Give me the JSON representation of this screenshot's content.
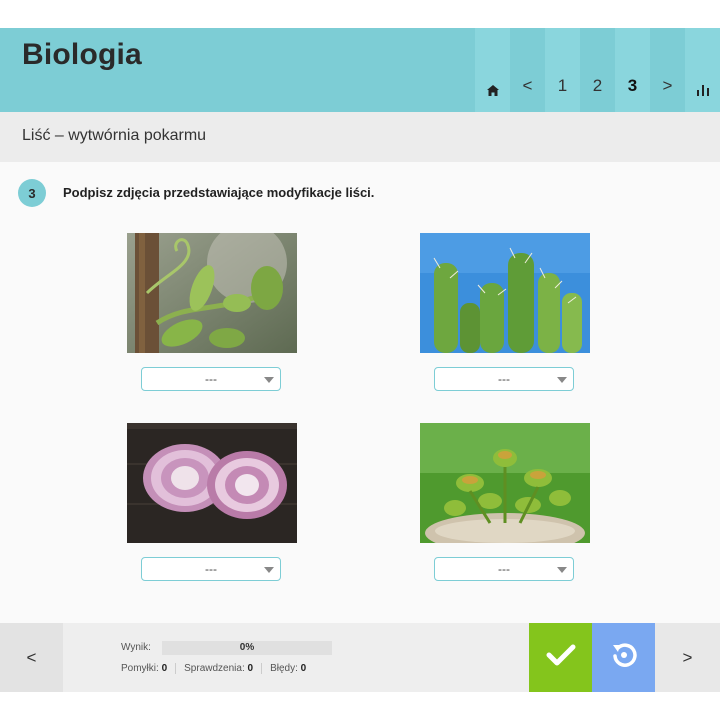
{
  "header": {
    "title": "Biologia",
    "nav": {
      "home_icon": "home-icon",
      "prev": "<",
      "pages": [
        "1",
        "2",
        "3"
      ],
      "active_page": "3",
      "next": ">",
      "stats_icon": "bar-chart-icon"
    }
  },
  "subtitle": "Liść – wytwórnia pokarmu",
  "task": {
    "number": "3",
    "instruction": "Podpisz zdjęcia przedstawiające modyfikacje liści."
  },
  "images": [
    {
      "subject": "pea tendril",
      "select_value": "---"
    },
    {
      "subject": "cactus spines",
      "select_value": "---"
    },
    {
      "subject": "onion bulb",
      "select_value": "---"
    },
    {
      "subject": "venus flytrap",
      "select_value": "---"
    }
  ],
  "footer": {
    "prev": "<",
    "next": ">",
    "score_label": "Wynik:",
    "score_value": "0%",
    "score_fraction": 0,
    "mistakes_label": "Pomyłki:",
    "mistakes_value": "0",
    "checks_label": "Sprawdzenia:",
    "checks_value": "0",
    "errors_label": "Błędy:",
    "errors_value": "0",
    "check_icon": "check-icon",
    "reset_icon": "reset-icon"
  },
  "colors": {
    "accent": "#7dcdd5",
    "check_button": "#84c51c",
    "reset_button": "#7aa8f1"
  }
}
